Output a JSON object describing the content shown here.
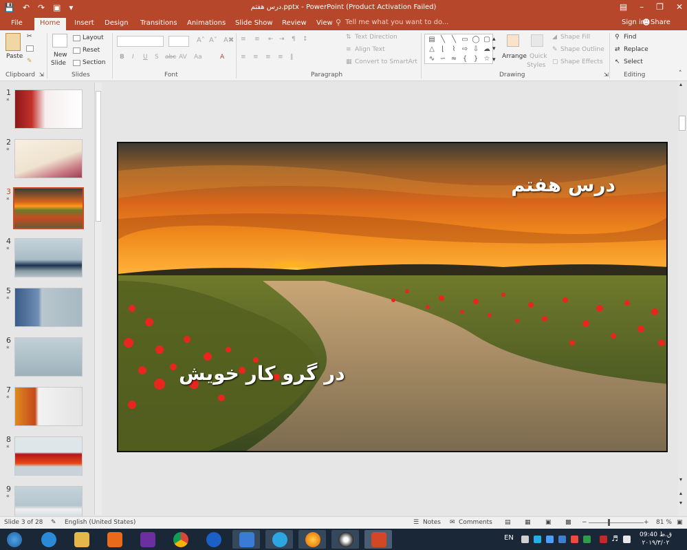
{
  "titlebar": {
    "title": "درس هفتم.pptx - PowerPoint (Product Activation Failed)"
  },
  "tabs": [
    "File",
    "Home",
    "Insert",
    "Design",
    "Transitions",
    "Animations",
    "Slide Show",
    "Review",
    "View"
  ],
  "tell_me": "Tell me what you want to do...",
  "account": {
    "sign_in": "Sign in",
    "share": "Share"
  },
  "ribbon": {
    "clipboard": {
      "paste": "Paste",
      "group": "Clipboard"
    },
    "slides": {
      "new_slide_1": "New",
      "new_slide_2": "Slide",
      "layout": "Layout",
      "reset": "Reset",
      "section": "Section",
      "group": "Slides"
    },
    "font": {
      "group": "Font"
    },
    "paragraph": {
      "text_direction": "Text Direction",
      "align_text": "Align Text",
      "convert_smartart": "Convert to SmartArt",
      "group": "Paragraph"
    },
    "drawing": {
      "arrange": "Arrange",
      "quick_1": "Quick",
      "quick_2": "Styles",
      "shape_fill": "Shape Fill",
      "shape_outline": "Shape Outline",
      "shape_effects": "Shape Effects",
      "group": "Drawing"
    },
    "editing": {
      "find": "Find",
      "replace": "Replace",
      "select": "Select",
      "group": "Editing"
    }
  },
  "thumbnails": [
    {
      "num": "1",
      "star": "*"
    },
    {
      "num": "2",
      "star": "*"
    },
    {
      "num": "3",
      "star": "*"
    },
    {
      "num": "4",
      "star": "*"
    },
    {
      "num": "5",
      "star": "*"
    },
    {
      "num": "6",
      "star": "*"
    },
    {
      "num": "7",
      "star": "*"
    },
    {
      "num": "8",
      "star": "*"
    },
    {
      "num": "9",
      "star": "*"
    }
  ],
  "slide": {
    "title": "درس هفتم",
    "subtitle": "در گرو کار خویش"
  },
  "status": {
    "slide_info": "Slide 3 of 28",
    "language": "English (United States)",
    "notes": "Notes",
    "comments": "Comments",
    "zoom": "81 %"
  },
  "taskbar": {
    "lang": "EN",
    "time": "09:40 ق.ظ",
    "date": "۲۰۱۹/۳/۰۲"
  },
  "colors": {
    "accent": "#b7472a",
    "selected_border": "#d24726"
  }
}
